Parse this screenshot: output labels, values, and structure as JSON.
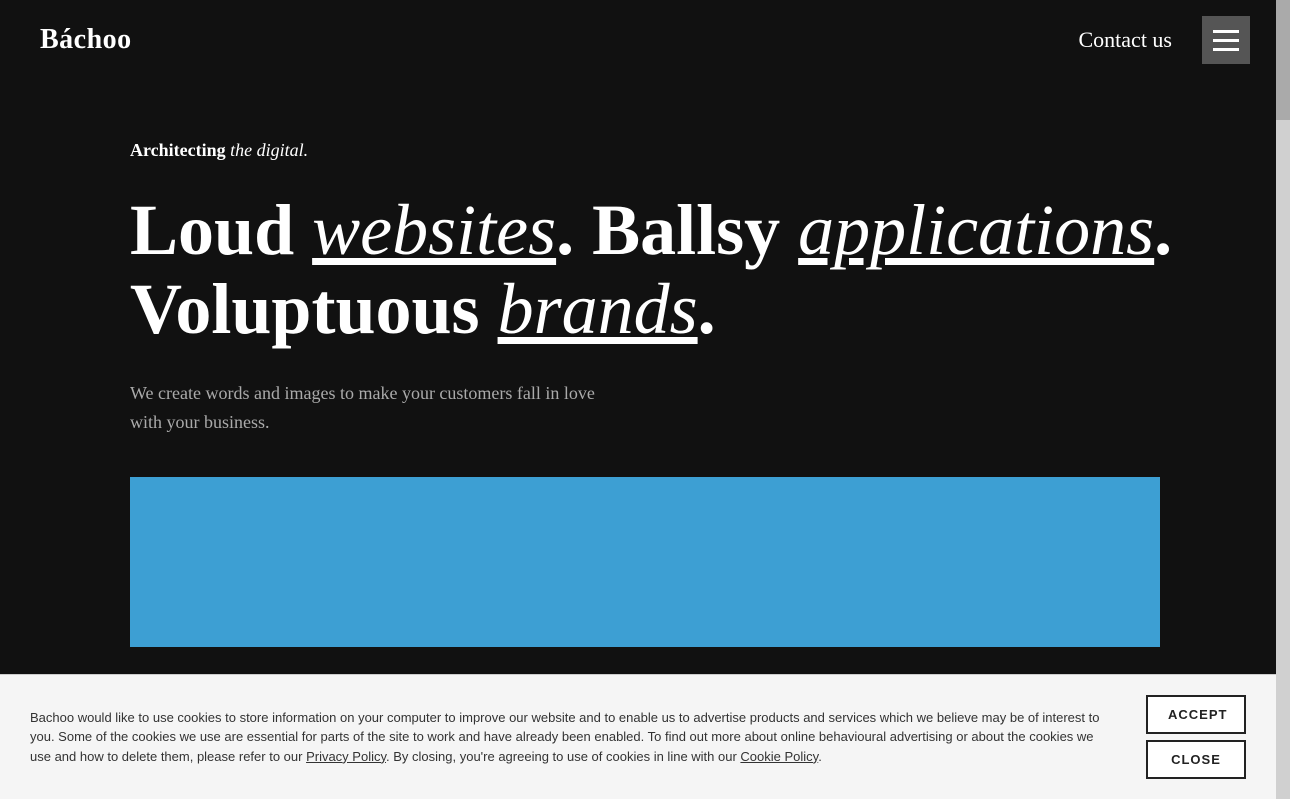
{
  "nav": {
    "logo": "Báchoo",
    "contact_label": "Contact us",
    "menu_icon": "≡"
  },
  "hero": {
    "architecting_bold": "Architecting",
    "architecting_italic": " the digital.",
    "headline_line1_bold1": "Loud ",
    "headline_line1_italic1": "websites",
    "headline_line1_punct1": ". ",
    "headline_line1_bold2": "Ballsy ",
    "headline_line1_italic2": "applications",
    "headline_line1_punct2": ".",
    "headline_line2_bold1": "Voluptuous ",
    "headline_line2_italic1": "brands",
    "headline_line2_punct1": ".",
    "subtext": "We create words and images to make your customers fall in love with your business."
  },
  "cookie": {
    "text1": "Bachoo would like to use cookies to store information on your computer to improve our website and to enable us to advertise products and services which we believe may be of interest to you. Some of the cookies we use are essential for parts of the site to work and have already been enabled. To find out more about online behavioural advertising or about the cookies we use and how to delete them, please refer to our ",
    "link1": "Privacy Policy",
    "text2": ". By closing, you're agreeing to use of cookies in line with our ",
    "link2": "Cookie Policy",
    "text3": ".",
    "accept_label": "ACCEPT",
    "close_label": "CLOSE"
  }
}
